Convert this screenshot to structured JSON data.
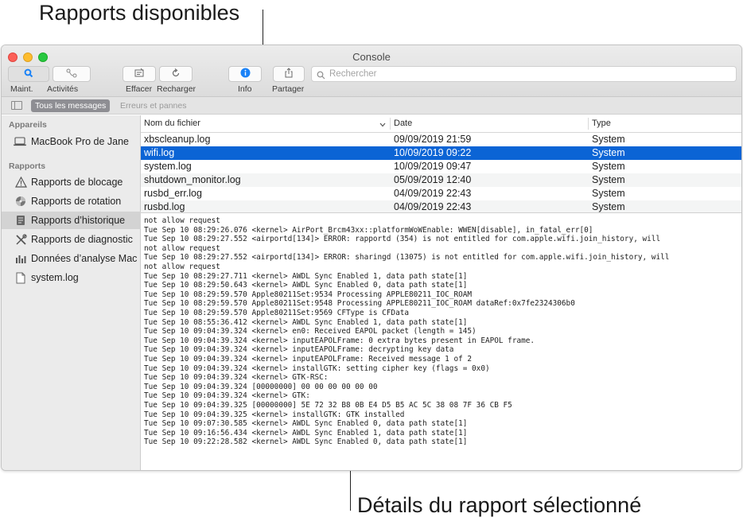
{
  "annotations": {
    "top": "Rapports disponibles",
    "bottom": "Détails du rapport sélectionné"
  },
  "window": {
    "title": "Console"
  },
  "toolbar": {
    "now_label": "Maint.",
    "activities_label": "Activités",
    "clear_label": "Effacer",
    "reload_label": "Recharger",
    "info_label": "Info",
    "share_label": "Partager"
  },
  "search": {
    "placeholder": "Rechercher"
  },
  "filters": {
    "all_messages": "Tous les messages",
    "errors_faults": "Erreurs et pannes"
  },
  "sidebar": {
    "devices_header": "Appareils",
    "device": "MacBook Pro de Jane",
    "reports_header": "Rapports",
    "items": [
      {
        "label": "Rapports de blocage",
        "icon": "warning-triangle-icon"
      },
      {
        "label": "Rapports de rotation",
        "icon": "spin-icon"
      },
      {
        "label": "Rapports d’historique",
        "icon": "document-icon"
      },
      {
        "label": "Rapports de diagnostic",
        "icon": "tools-icon"
      },
      {
        "label": "Données d’analyse Mac",
        "icon": "bar-chart-icon"
      },
      {
        "label": "system.log",
        "icon": "file-icon"
      }
    ],
    "selected_index": 2
  },
  "table": {
    "columns": [
      "Nom du fichier",
      "Date",
      "Type"
    ],
    "rows": [
      {
        "name": "xbscleanup.log",
        "date": "09/09/2019 21:59",
        "type": "System"
      },
      {
        "name": "wifi.log",
        "date": "10/09/2019 09:22",
        "type": "System"
      },
      {
        "name": "system.log",
        "date": "10/09/2019 09:47",
        "type": "System"
      },
      {
        "name": "shutdown_monitor.log",
        "date": "05/09/2019 12:40",
        "type": "System"
      },
      {
        "name": "rusbd_err.log",
        "date": "04/09/2019 22:43",
        "type": "System"
      },
      {
        "name": "rusbd.log",
        "date": "04/09/2019 22:43",
        "type": "System"
      }
    ],
    "selected_index": 1
  },
  "log_lines": [
    "not allow request",
    "Tue Sep 10 08:29:26.076 <kernel> AirPort_Brcm43xx::platformWoWEnable: WWEN[disable], in_fatal_err[0]",
    "Tue Sep 10 08:29:27.552 <airportd[134]> ERROR: rapportd (354) is not entitled for com.apple.wifi.join_history, will",
    "not allow request",
    "Tue Sep 10 08:29:27.552 <airportd[134]> ERROR: sharingd (13075) is not entitled for com.apple.wifi.join_history, will",
    "not allow request",
    "Tue Sep 10 08:29:27.711 <kernel> AWDL Sync Enabled 1, data path state[1]",
    "Tue Sep 10 08:29:50.643 <kernel> AWDL Sync Enabled 0, data path state[1]",
    "Tue Sep 10 08:29:59.570 Apple80211Set:9534 Processing APPLE80211_IOC_ROAM",
    "Tue Sep 10 08:29:59.570 Apple80211Set:9548 Processing APPLE80211_IOC_ROAM dataRef:0x7fe2324306b0",
    "Tue Sep 10 08:29:59.570 Apple80211Set:9569 CFType is CFData",
    "Tue Sep 10 08:55:36.412 <kernel> AWDL Sync Enabled 1, data path state[1]",
    "Tue Sep 10 09:04:39.324 <kernel> en0: Received EAPOL packet (length = 145)",
    "Tue Sep 10 09:04:39.324 <kernel> inputEAPOLFrame: 0 extra bytes present in EAPOL frame.",
    "Tue Sep 10 09:04:39.324 <kernel> inputEAPOLFrame: decrypting key data",
    "Tue Sep 10 09:04:39.324 <kernel> inputEAPOLFrame: Received message 1 of 2",
    "Tue Sep 10 09:04:39.324 <kernel> installGTK: setting cipher key (flags = 0x0)",
    "Tue Sep 10 09:04:39.324 <kernel> GTK-RSC:",
    "Tue Sep 10 09:04:39.324 [00000000] 00 00 00 00 00 00",
    "Tue Sep 10 09:04:39.324 <kernel> GTK:",
    "Tue Sep 10 09:04:39.325 [00000000] 5E 72 32 B8 0B E4 D5 B5 AC 5C 38 08 7F 36 CB F5",
    "Tue Sep 10 09:04:39.325 <kernel> installGTK: GTK installed",
    "Tue Sep 10 09:07:30.585 <kernel> AWDL Sync Enabled 0, data path state[1]",
    "Tue Sep 10 09:16:56.434 <kernel> AWDL Sync Enabled 1, data path state[1]",
    "Tue Sep 10 09:22:28.582 <kernel> AWDL Sync Enabled 0, data path state[1]"
  ],
  "colors": {
    "selection": "#0b64d5",
    "accent_blue": "#1a82f7"
  }
}
